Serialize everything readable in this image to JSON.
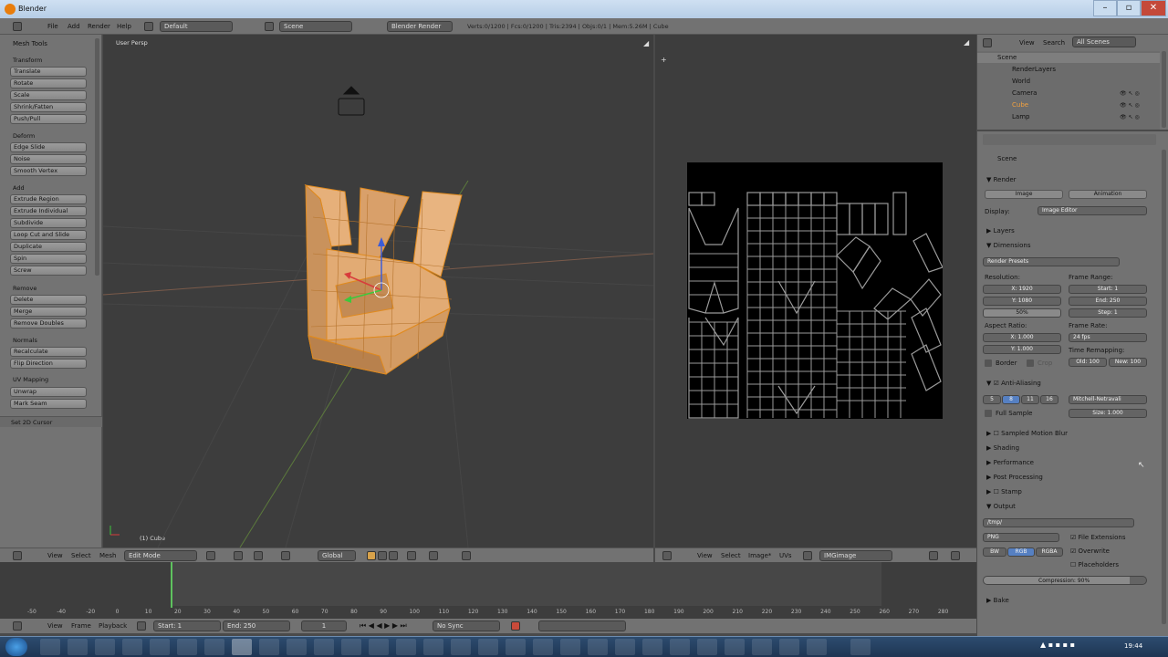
{
  "window": {
    "title": "Blender",
    "controls": [
      "–",
      "▫",
      "✕"
    ]
  },
  "topbar": {
    "menus": [
      "File",
      "Add",
      "Render",
      "Help"
    ],
    "screen_layout": "Default",
    "scene": "Scene",
    "engine": "Blender Render",
    "stats": "Verts:0/1200 | Fcs:0/1200 | Tris:2394 | Objs:0/1 | Mem:5.26M | Cube"
  },
  "toolshelf": {
    "title": "Mesh Tools",
    "sections": [
      {
        "name": "Transform",
        "buttons": [
          "Translate",
          "Rotate",
          "Scale",
          "Shrink/Fatten",
          "Push/Pull"
        ]
      },
      {
        "name": "Deform",
        "buttons": [
          "Edge Slide",
          "Noise",
          "Smooth Vertex"
        ]
      },
      {
        "name": "Add",
        "buttons": [
          "Extrude Region",
          "Extrude Individual",
          "Subdivide",
          "Loop Cut and Slide",
          "Duplicate",
          "Spin",
          "Screw"
        ]
      },
      {
        "name": "Remove",
        "buttons": [
          "Delete",
          "Merge",
          "Remove Doubles"
        ]
      },
      {
        "name": "Normals",
        "buttons": [
          "Recalculate",
          "Flip Direction"
        ]
      },
      {
        "name": "UV Mapping",
        "buttons": [
          "Unwrap",
          "Mark Seam"
        ]
      }
    ],
    "footer": "Set 2D Cursor"
  },
  "viewport": {
    "label": "User Persp",
    "object_label": "(1) Cube",
    "header": {
      "menus": [
        "View",
        "Select",
        "Mesh"
      ],
      "mode": "Edit Mode",
      "orientation": "Global"
    }
  },
  "uv_editor": {
    "header": {
      "menus": [
        "View",
        "Select",
        "Image*",
        "UVs"
      ],
      "image": "IMGimage"
    }
  },
  "outliner": {
    "menus": [
      "View",
      "Search"
    ],
    "filter": "All Scenes",
    "items": [
      "Scene",
      "RenderLayers",
      "World",
      "Camera",
      "Cube",
      "Lamp"
    ]
  },
  "properties": {
    "context": "Scene",
    "render": {
      "title": "Render",
      "image_btn": "Image",
      "animation_btn": "Animation",
      "display_label": "Display:",
      "display_value": "Image Editor"
    },
    "layers": "Layers",
    "dimensions": {
      "title": "Dimensions",
      "presets": "Render Presets",
      "resolution_label": "Resolution:",
      "res_x": "X: 1920",
      "res_y": "Y: 1080",
      "res_pct": "50%",
      "frame_range_label": "Frame Range:",
      "start": "Start: 1",
      "end": "End: 250",
      "step": "Step: 1",
      "aspect_label": "Aspect Ratio:",
      "asp_x": "X: 1.000",
      "asp_y": "Y: 1.000",
      "frame_rate_label": "Frame Rate:",
      "fps": "24 fps",
      "time_remap_label": "Time Remapping:",
      "old": "Old: 100",
      "new": "New: 100",
      "border": "Border",
      "crop": "Crop"
    },
    "anti_aliasing": {
      "title": "Anti-Aliasing",
      "samples": [
        "5",
        "8",
        "11",
        "16"
      ],
      "filter": "Mitchell-Netravali",
      "full_sample": "Full Sample",
      "size": "Size: 1.000"
    },
    "collapsed": [
      "Sampled Motion Blur",
      "Shading",
      "Performance",
      "Post Processing",
      "Stamp"
    ],
    "output": {
      "title": "Output",
      "path": "/tmp/",
      "format": "PNG",
      "file_ext": "File Extensions",
      "overwrite": "Overwrite",
      "placeholders": "Placeholders",
      "bw": "BW",
      "rgb": "RGB",
      "rgba": "RGBA",
      "compression": "Compression: 90%"
    },
    "bake": "Bake"
  },
  "timeline": {
    "ticks": [
      "-50",
      "-40",
      "-20",
      "0",
      "10",
      "20",
      "30",
      "40",
      "50",
      "60",
      "70",
      "80",
      "90",
      "100",
      "110",
      "120",
      "130",
      "140",
      "150",
      "160",
      "170",
      "180",
      "190",
      "200",
      "210",
      "220",
      "230",
      "240",
      "250",
      "260",
      "270",
      "280"
    ],
    "menus": [
      "View",
      "Frame",
      "Playback"
    ],
    "start": "Start: 1",
    "end": "End: 250",
    "current": "1",
    "sync": "No Sync"
  },
  "taskbar": {
    "clock": "19:44"
  }
}
